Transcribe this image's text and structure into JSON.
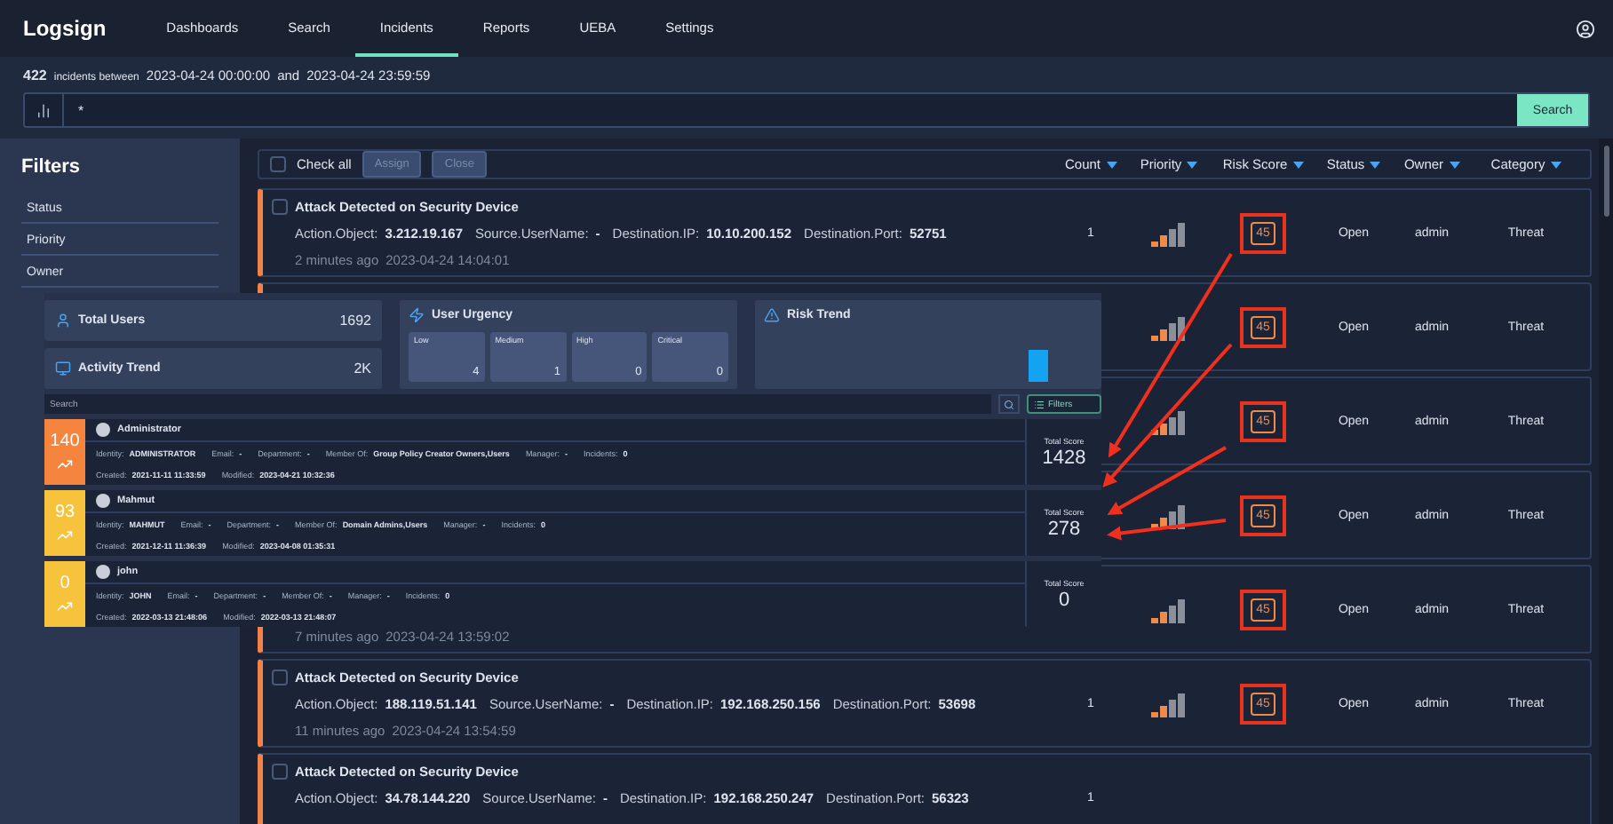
{
  "nav": {
    "logo": "Logsign",
    "tabs": [
      {
        "label": "Dashboards",
        "selected": false
      },
      {
        "label": "Search",
        "selected": false
      },
      {
        "label": "Incidents",
        "selected": true
      },
      {
        "label": "Reports",
        "selected": false
      },
      {
        "label": "UEBA",
        "selected": false
      },
      {
        "label": "Settings",
        "selected": false
      }
    ]
  },
  "summary": {
    "count": "422",
    "text": "incidents between",
    "from": "2023-04-24 00:00:00",
    "joiner": "and",
    "to": "2023-04-24 23:59:59"
  },
  "query": {
    "value": "*",
    "button": "Search"
  },
  "filters": {
    "title": "Filters",
    "items": [
      "Status",
      "Priority",
      "Owner"
    ]
  },
  "toolbar": {
    "check_all": {
      "label": "Check all",
      "checked": false
    },
    "buttons": [
      {
        "label": "Assign",
        "disabled": true
      },
      {
        "label": "Close",
        "disabled": true
      }
    ],
    "columns": [
      "Count",
      "Priority",
      "Risk Score",
      "Status",
      "Owner",
      "Category"
    ]
  },
  "incidents": [
    {
      "checked": false,
      "title": "Attack Detected on Security Device",
      "fields": [
        {
          "label": "Action.Object:",
          "value": "3.212.19.167"
        },
        {
          "label": "Source.UserName:",
          "value": "-"
        },
        {
          "label": "Destination.IP:",
          "value": "10.10.200.152"
        },
        {
          "label": "Destination.Port:",
          "value": "52751"
        }
      ],
      "age": "2 minutes ago",
      "time": "2023-04-24 14:04:01",
      "count": "1",
      "level": 0.5,
      "risk_score": "45",
      "highlighted": true,
      "status": "Open",
      "owner": "admin",
      "category": "Threat"
    },
    {
      "level": 0.5,
      "risk_score": "45",
      "highlighted": true,
      "status": "Open",
      "owner": "admin",
      "category": "Threat"
    },
    {
      "level": 0.5,
      "risk_score": "45",
      "highlighted": true,
      "status": "Open",
      "owner": "admin",
      "category": "Threat"
    },
    {
      "level": 0.5,
      "risk_score": "45",
      "highlighted": true,
      "status": "Open",
      "owner": "admin",
      "category": "Threat"
    },
    {
      "age": "7 minutes ago",
      "time": "2023-04-24 13:59:02",
      "level": 0.5,
      "risk_score": "45",
      "highlighted": true,
      "status": "Open",
      "owner": "admin",
      "category": "Threat"
    },
    {
      "checked": false,
      "title": "Attack Detected on Security Device",
      "fields": [
        {
          "label": "Action.Object:",
          "value": "188.119.51.141"
        },
        {
          "label": "Source.UserName:",
          "value": "-"
        },
        {
          "label": "Destination.IP:",
          "value": "192.168.250.156"
        },
        {
          "label": "Destination.Port:",
          "value": "53698"
        }
      ],
      "age": "11 minutes ago",
      "time": "2023-04-24 13:54:59",
      "count": "1",
      "level": 0.5,
      "risk_score": "45",
      "highlighted": true,
      "status": "Open",
      "owner": "admin",
      "category": "Threat"
    },
    {
      "checked": false,
      "title": "Attack Detected on Security Device",
      "fields": [
        {
          "label": "Action.Object:",
          "value": "34.78.144.220"
        },
        {
          "label": "Source.UserName:",
          "value": "-"
        },
        {
          "label": "Destination.IP:",
          "value": "192.168.250.247"
        },
        {
          "label": "Destination.Port:",
          "value": "56323"
        }
      ],
      "count": "1"
    }
  ],
  "ueba": {
    "stats": [
      {
        "kind": "users",
        "label": "Total Users",
        "value": "1692"
      },
      {
        "kind": "activity",
        "label": "Activity Trend",
        "value": "2K"
      }
    ],
    "urgency": {
      "title": "User Urgency",
      "levels": [
        {
          "label": "Low",
          "value": "4"
        },
        {
          "label": "Medium",
          "value": "1"
        },
        {
          "label": "High",
          "value": "0"
        },
        {
          "label": "Critical",
          "value": "0"
        }
      ]
    },
    "risk_trend": {
      "title": "Risk Trend"
    },
    "search": {
      "placeholder": "Search"
    },
    "filters_button": "Filters",
    "users": [
      {
        "score": "140",
        "color": "#f5843f",
        "name": "Administrator",
        "fields": [
          {
            "label": "Identity:",
            "value": "ADMINISTRATOR"
          },
          {
            "label": "Email:",
            "value": "-"
          },
          {
            "label": "Department:",
            "value": "-"
          },
          {
            "label": "Member Of:",
            "value": "Group Policy Creator Owners,Users"
          },
          {
            "label": "Manager:",
            "value": "-"
          },
          {
            "label": "Incidents:",
            "value": "0"
          }
        ],
        "dates": [
          {
            "label": "Created:",
            "value": "2021-11-11 11:33:59"
          },
          {
            "label": "Modified:",
            "value": "2023-04-21 10:32:36"
          }
        ],
        "total_label": "Total Score",
        "total": "1428"
      },
      {
        "score": "93",
        "color": "#f7c23c",
        "name": "Mahmut",
        "fields": [
          {
            "label": "Identity:",
            "value": "MAHMUT"
          },
          {
            "label": "Email:",
            "value": "-"
          },
          {
            "label": "Department:",
            "value": "-"
          },
          {
            "label": "Member Of:",
            "value": "Domain Admins,Users"
          },
          {
            "label": "Manager:",
            "value": "-"
          },
          {
            "label": "Incidents:",
            "value": "0"
          }
        ],
        "dates": [
          {
            "label": "Created:",
            "value": "2021-12-11 11:36:39"
          },
          {
            "label": "Modified:",
            "value": "2023-04-08 01:35:31"
          }
        ],
        "total_label": "Total Score",
        "total": "278"
      },
      {
        "score": "0",
        "color": "#f7c23c",
        "name": "john",
        "fields": [
          {
            "label": "Identity:",
            "value": "JOHN"
          },
          {
            "label": "Email:",
            "value": "-"
          },
          {
            "label": "Department:",
            "value": "-"
          },
          {
            "label": "Member Of:",
            "value": "-"
          },
          {
            "label": "Manager:",
            "value": "-"
          },
          {
            "label": "Incidents:",
            "value": "0"
          }
        ],
        "dates": [
          {
            "label": "Created:",
            "value": "2022-03-13 21:48:06"
          },
          {
            "label": "Modified:",
            "value": "2022-03-13 21:48:07"
          }
        ],
        "total_label": "Total Score",
        "total": "0"
      }
    ]
  }
}
